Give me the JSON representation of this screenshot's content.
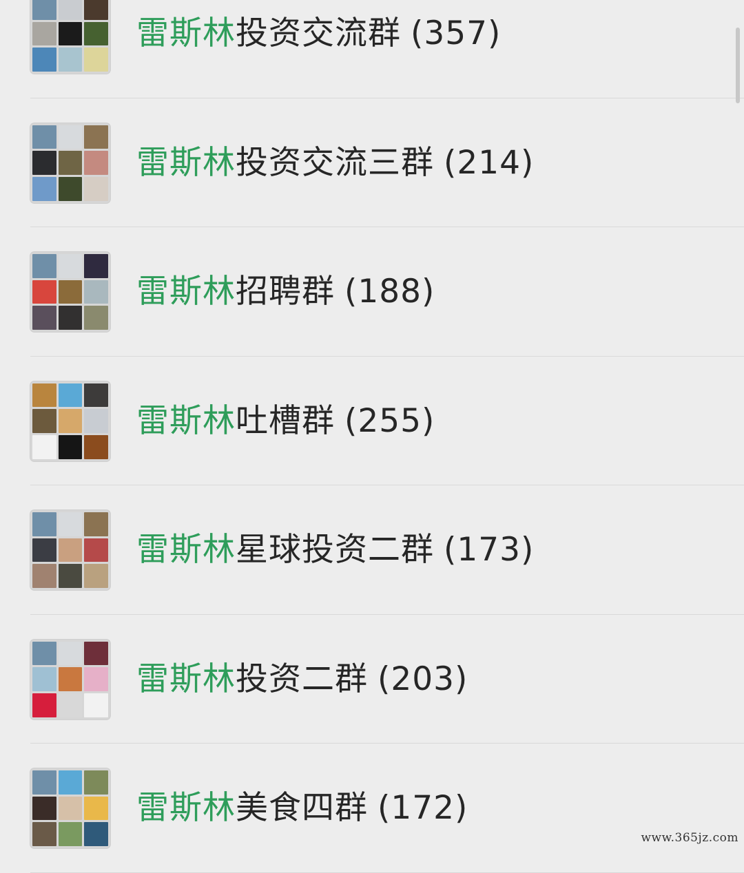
{
  "list": {
    "highlight_prefix": "雷斯林",
    "highlight_color": "#2e9d5a",
    "groups": [
      {
        "title_rest": "投资交流群",
        "member_count": "(357)",
        "avatar_colors": [
          "#6f8fa8",
          "#c9ccd0",
          "#4b3a2d",
          "#a9a6a0",
          "#1b1b1b",
          "#466130",
          "#4d87b8",
          "#a8c4cf",
          "#ddd59a"
        ]
      },
      {
        "title_rest": "投资交流三群",
        "member_count": "(214)",
        "avatar_colors": [
          "#6f8fa8",
          "#d7dadd",
          "#8b7352",
          "#2b2c2f",
          "#6f6545",
          "#c48a80",
          "#6f9ac9",
          "#3e4a2c",
          "#d6cdc4"
        ]
      },
      {
        "title_rest": "招聘群",
        "member_count": "(188)",
        "avatar_colors": [
          "#6f8fa8",
          "#d7dadd",
          "#2f2a3f",
          "#d8463d",
          "#8b6b3a",
          "#a9b8be",
          "#5a4f5c",
          "#323030",
          "#8a8a6e"
        ]
      },
      {
        "title_rest": "吐槽群",
        "member_count": "(255)",
        "avatar_colors": [
          "#b9853e",
          "#5aa9d6",
          "#3d3b3a",
          "#6c5a3d",
          "#d6a86a",
          "#c8ccd2",
          "#f2f2f2",
          "#151515",
          "#8b4c1e"
        ]
      },
      {
        "title_rest": "星球投资二群",
        "member_count": "(173)",
        "avatar_colors": [
          "#6f8fa8",
          "#d7dadd",
          "#8b7352",
          "#3b3d44",
          "#c9a080",
          "#b54a4a",
          "#a08270",
          "#4a4a40",
          "#b9a17f"
        ]
      },
      {
        "title_rest": "投资二群",
        "member_count": "(203)",
        "avatar_colors": [
          "#6f8fa8",
          "#d7dadd",
          "#6e2f3a",
          "#9fc0d3",
          "#c9783f",
          "#e6b0c8",
          "#d61e3c",
          "#d8d8d8",
          "#f2f2f2"
        ]
      },
      {
        "title_rest": "美食四群",
        "member_count": "(172)",
        "avatar_colors": [
          "#6f8fa8",
          "#5aa9d6",
          "#7d8a5a",
          "#3a2c28",
          "#d6c0a8",
          "#e9b84a",
          "#6a5a48",
          "#7a9a60",
          "#2f5a7a"
        ]
      }
    ]
  },
  "watermark": "www.365jz.com"
}
